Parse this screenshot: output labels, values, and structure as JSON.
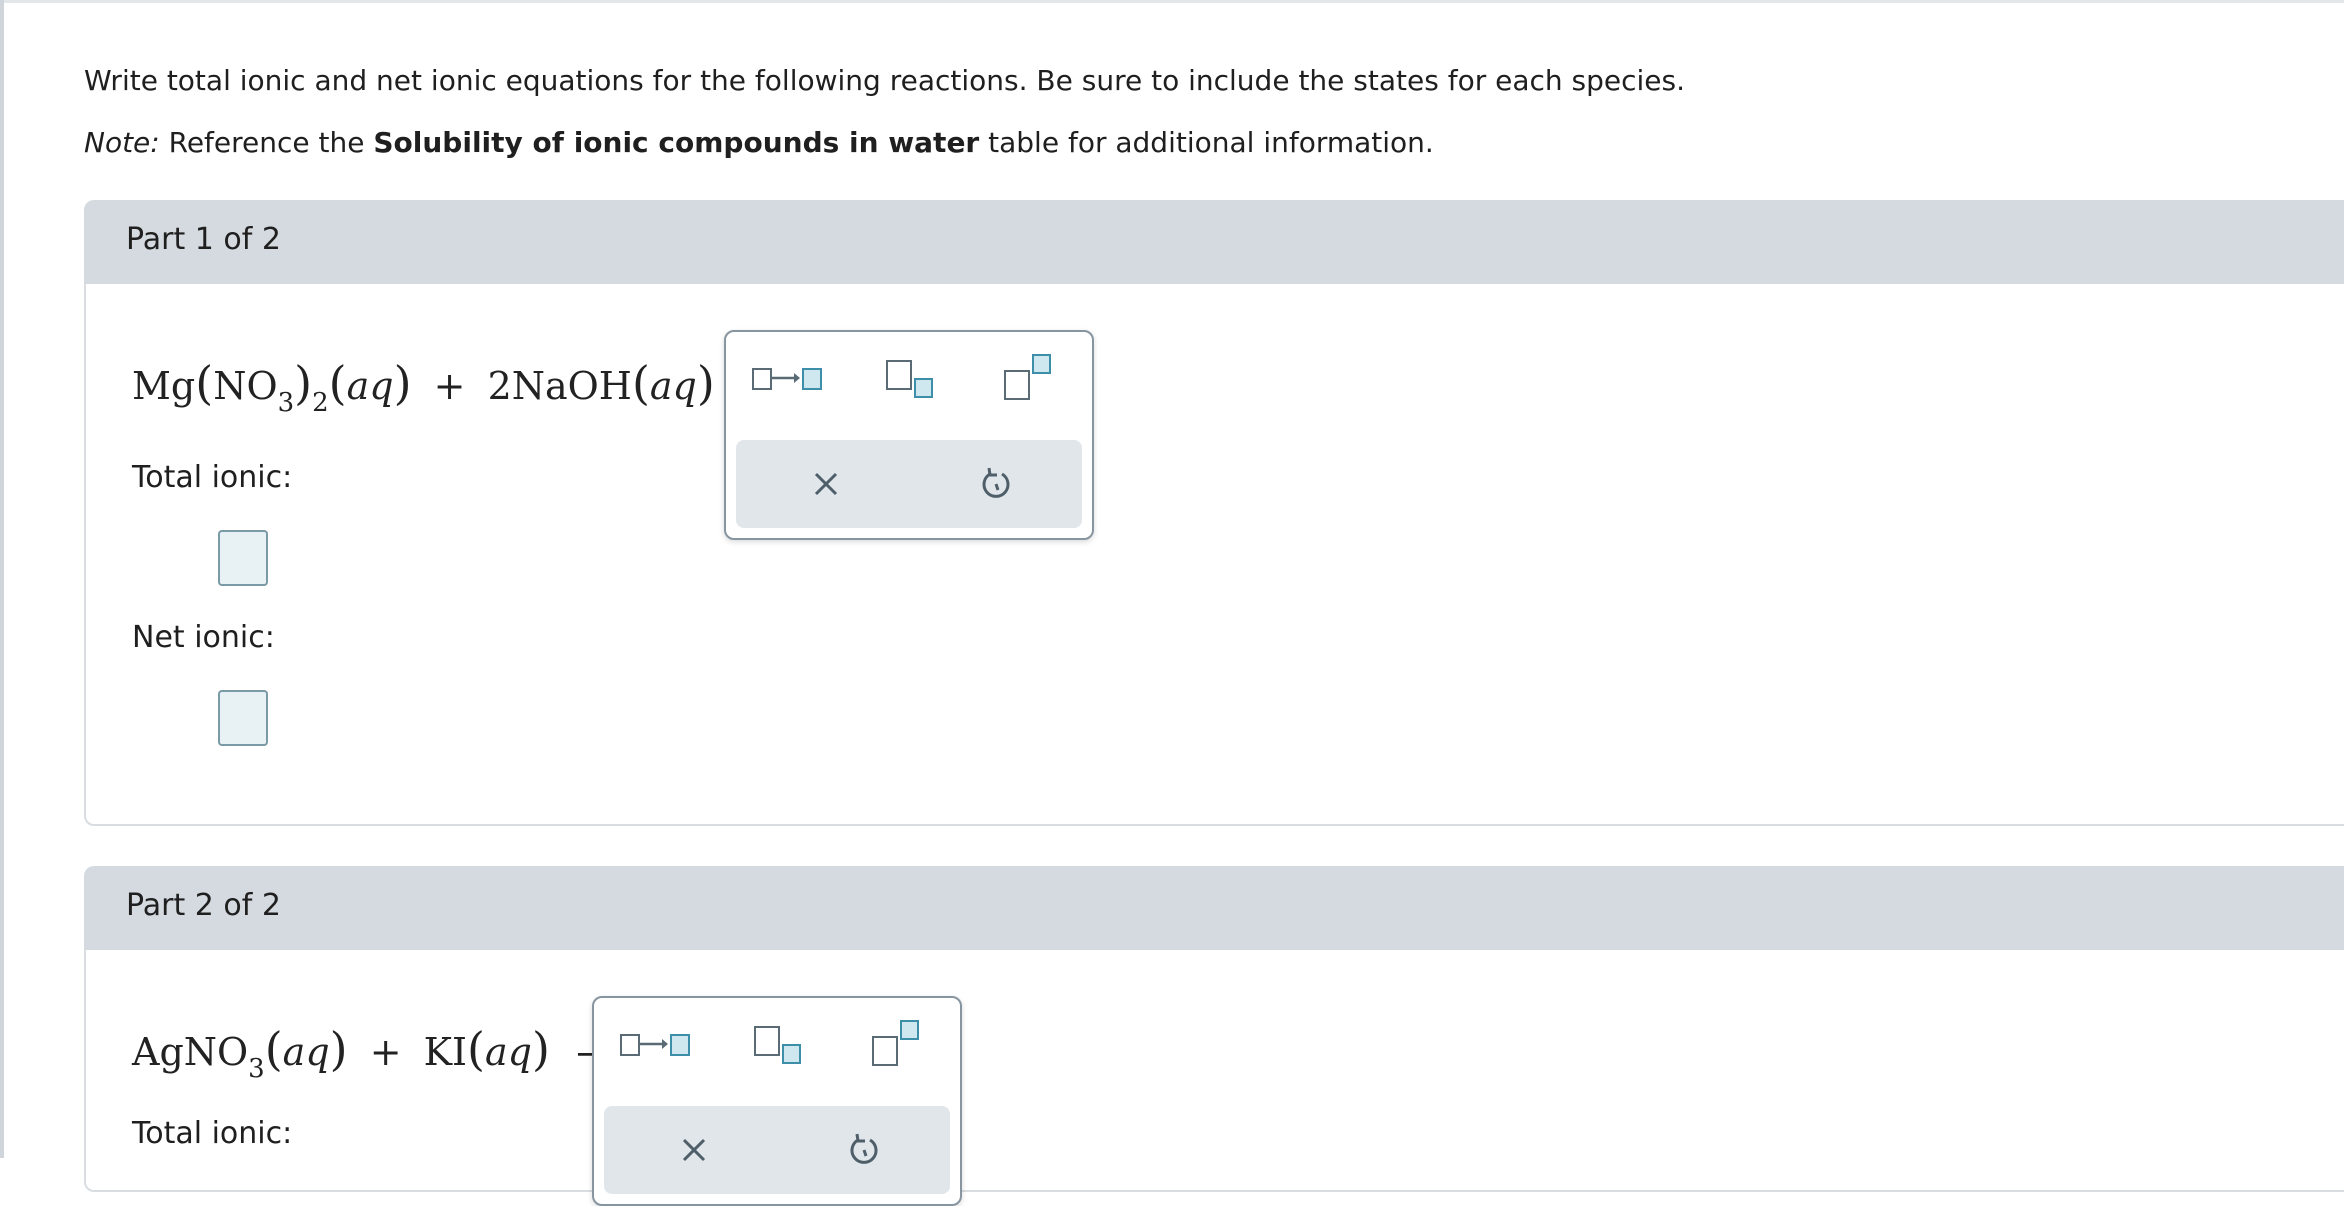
{
  "instructions": {
    "line1": "Write total ionic and net ionic equations for the following reactions. Be sure to include the states for each species.",
    "note_prefix": "Note:",
    "note_text_1": " Reference the ",
    "note_bold": "Solubility of ionic compounds in water",
    "note_text_2": " table for additional information."
  },
  "parts": [
    {
      "header": "Part 1 of 2",
      "equation": {
        "mg": "Mg",
        "no3": "NO",
        "sub3": "3",
        "sub2": "2",
        "aq": "aq",
        "plus": "+",
        "naoh": "2NaOH",
        "aq2": "aq",
        "arrow": "→"
      },
      "total_label": "Total ionic:",
      "net_label": "Net ionic:"
    },
    {
      "header": "Part 2 of 2",
      "equation": {
        "agno": "AgNO",
        "sub3": "3",
        "aq": "aq",
        "plus": "+",
        "ki": "KI",
        "aq2": "aq",
        "arrow": "→"
      },
      "total_label": "Total ionic:"
    }
  ],
  "palette": {
    "tools": [
      "reaction-arrow-icon",
      "subscript-icon",
      "superscript-icon"
    ],
    "actions": [
      "clear-icon",
      "undo-icon"
    ]
  }
}
